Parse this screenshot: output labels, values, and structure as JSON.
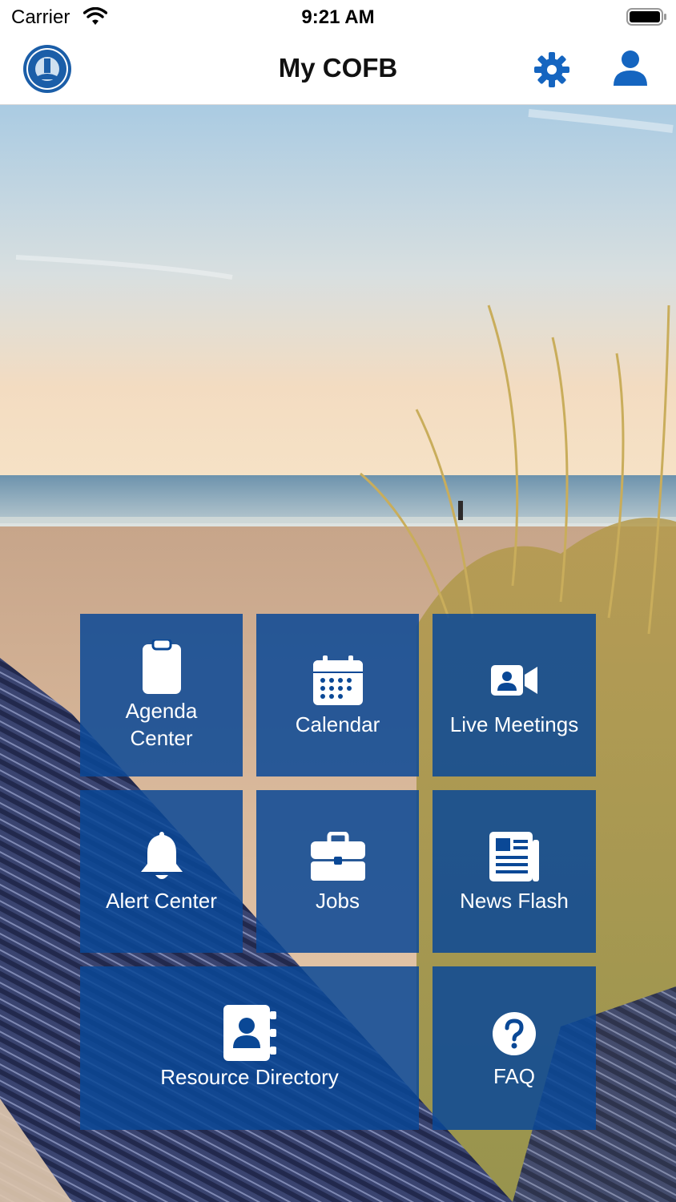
{
  "status_bar": {
    "carrier": "Carrier",
    "time": "9:21 AM"
  },
  "nav": {
    "title": "My COFB"
  },
  "colors": {
    "tile_blue": "#0A4896",
    "nav_icon_blue": "#1565C0"
  },
  "tiles": [
    {
      "label_line1": "Agenda",
      "label_line2": "Center",
      "icon": "clipboard-icon"
    },
    {
      "label": "Calendar",
      "icon": "calendar-icon"
    },
    {
      "label": "Live Meetings",
      "icon": "video-camera-icon"
    },
    {
      "label": "Alert Center",
      "icon": "bell-icon"
    },
    {
      "label": "Jobs",
      "icon": "briefcase-icon"
    },
    {
      "label": "News Flash",
      "icon": "newspaper-icon"
    },
    {
      "label": "Resource Directory",
      "icon": "contact-book-icon"
    },
    {
      "label": "FAQ",
      "icon": "question-circle-icon"
    }
  ]
}
